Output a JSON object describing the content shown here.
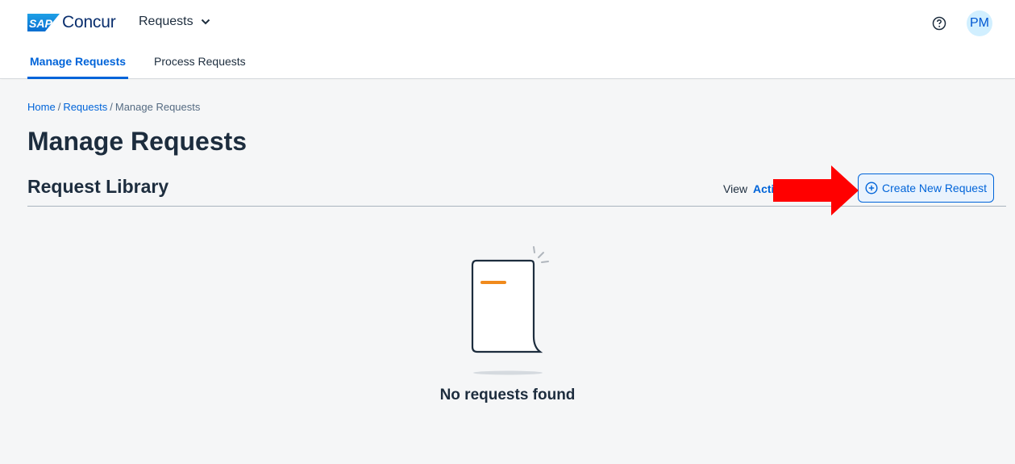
{
  "brand": {
    "badge": "SAP",
    "name": "Concur"
  },
  "header": {
    "module_label": "Requests",
    "avatar_initials": "PM"
  },
  "tabs": [
    {
      "label": "Manage Requests",
      "active": true
    },
    {
      "label": "Process Requests",
      "active": false
    }
  ],
  "breadcrumb": {
    "home": "Home",
    "requests": "Requests",
    "current": "Manage Requests",
    "separator": "/"
  },
  "page": {
    "title": "Manage Requests",
    "section_title": "Request Library",
    "view_label": "View",
    "view_value": "Active",
    "create_button_label": "Create New Request",
    "empty_message": "No requests found"
  },
  "colors": {
    "accent": "#0064d9",
    "text": "#1d2d3e",
    "annotation_arrow": "#ff0000",
    "illustration_accent": "#f08a1c"
  }
}
